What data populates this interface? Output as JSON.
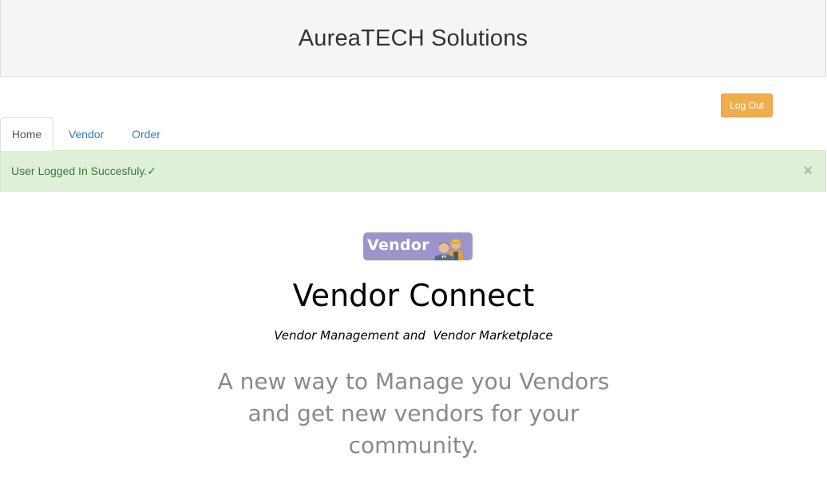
{
  "header": {
    "title": "AureaTECH Solutions"
  },
  "toolbar": {
    "logout_label": "Log Out"
  },
  "tabs": [
    {
      "label": "Home",
      "active": true
    },
    {
      "label": "Vendor",
      "active": false
    },
    {
      "label": "Order",
      "active": false
    }
  ],
  "alert": {
    "message": "User Logged In Succesfuly.✓",
    "close_symbol": "×"
  },
  "hero": {
    "logo_text": "Vendor",
    "title": "Vendor Connect",
    "subtitle": "Vendor Management and  Vendor Marketplace",
    "tagline": "A new way to Manage you Vendors and get new vendors for your community."
  },
  "colors": {
    "header_bg": "#f5f5f5",
    "logout_bg": "#f0ad4e",
    "link": "#337ab7",
    "alert_bg": "#dff0d8",
    "alert_text": "#3c763d",
    "logo_bg": "#9b95c9",
    "tagline": "#8a8a8a"
  }
}
